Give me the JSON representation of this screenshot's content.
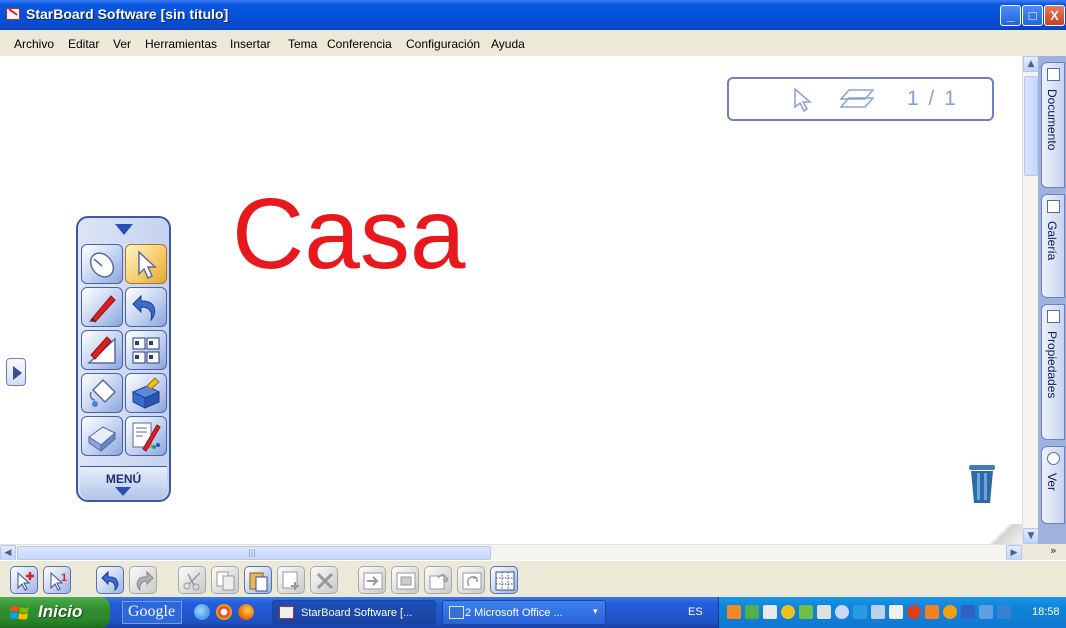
{
  "window": {
    "title": "StarBoard Software [sin título]",
    "buttons": {
      "minimize": "_",
      "maximize": "□",
      "close": "X"
    }
  },
  "menu": [
    "Archivo",
    "Editar",
    "Ver",
    "Herramientas",
    "Insertar",
    "Tema",
    "Conferencia",
    "Configuración",
    "Ayuda"
  ],
  "canvas": {
    "text": "Casa",
    "text_color": "#e8181c",
    "page_indicator": "1 / 1"
  },
  "palette": {
    "menu_label": "MENÚ",
    "tools": [
      {
        "icon": "mouse-icon",
        "selected": false
      },
      {
        "icon": "arrow-pointer-icon",
        "selected": true
      },
      {
        "icon": "pen-icon",
        "selected": false
      },
      {
        "icon": "undo-icon",
        "selected": false
      },
      {
        "icon": "pen-ruler-icon",
        "selected": false
      },
      {
        "icon": "page-sorter-icon",
        "selected": false
      },
      {
        "icon": "paint-bucket-icon",
        "selected": false
      },
      {
        "icon": "toolbox-icon",
        "selected": false
      },
      {
        "icon": "eraser-icon",
        "selected": false
      },
      {
        "icon": "pen-settings-icon",
        "selected": false
      }
    ]
  },
  "side_tabs": [
    "Documento",
    "Galería",
    "Propiedades",
    "Ver"
  ],
  "scrollbar": {
    "chevron": "»"
  },
  "bottom_toolbar": [
    {
      "icon": "new-page-icon",
      "enabled": true
    },
    {
      "icon": "page-one-icon",
      "enabled": true
    },
    {
      "icon": "undo-icon",
      "enabled": true
    },
    {
      "icon": "redo-icon",
      "enabled": false
    },
    {
      "icon": "cut-icon",
      "enabled": false
    },
    {
      "icon": "copy-icon",
      "enabled": false
    },
    {
      "icon": "paste-icon",
      "enabled": true
    },
    {
      "icon": "duplicate-icon",
      "enabled": false
    },
    {
      "icon": "delete-icon",
      "enabled": false
    },
    {
      "icon": "send-back-icon",
      "enabled": false
    },
    {
      "icon": "bring-front-icon",
      "enabled": false
    },
    {
      "icon": "rotate-icon",
      "enabled": false
    },
    {
      "icon": "flip-icon",
      "enabled": false
    },
    {
      "icon": "grid-icon",
      "enabled": true
    }
  ],
  "taskbar": {
    "start_label": "Inicio",
    "google_label": "Google",
    "tasks": [
      {
        "label": "StarBoard Software [..."
      },
      {
        "label": "2 Microsoft Office ..."
      }
    ],
    "language": "ES",
    "clock": "18:58"
  }
}
